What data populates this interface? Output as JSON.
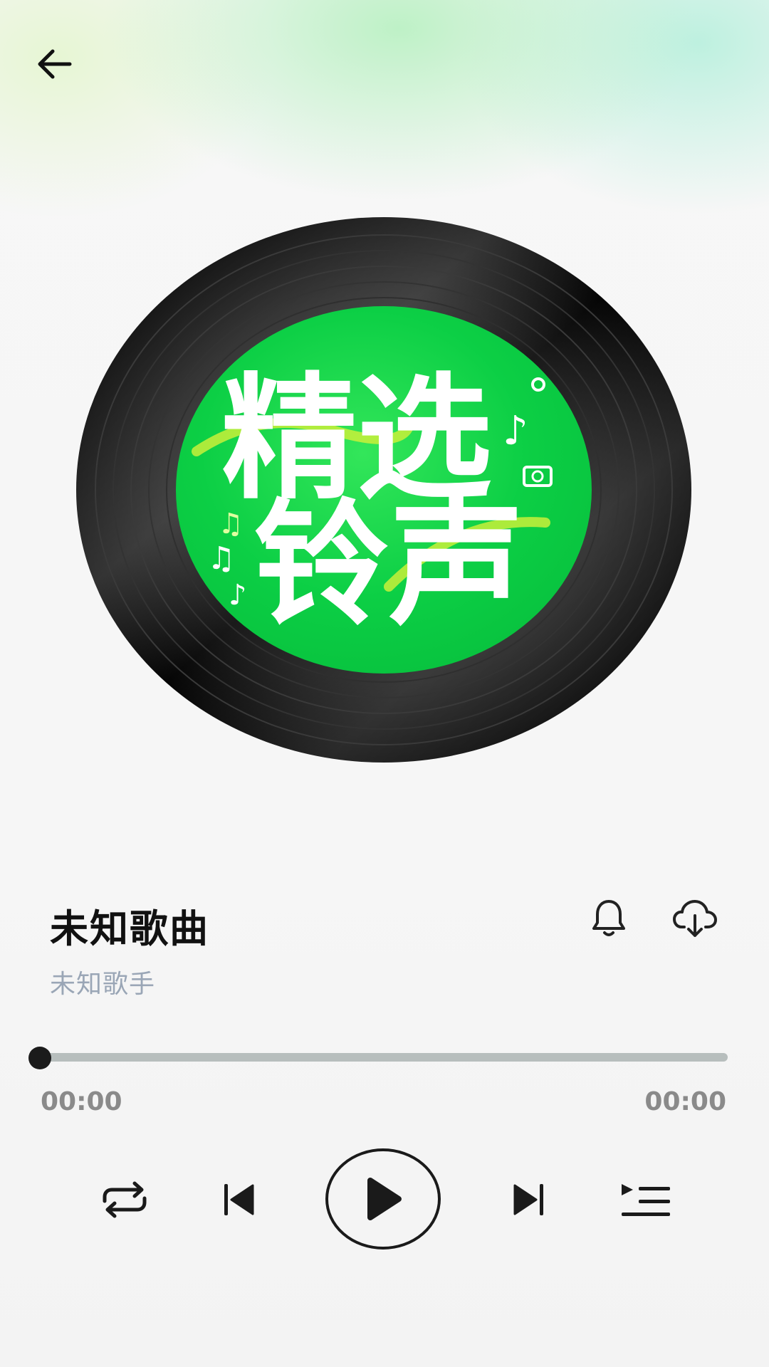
{
  "header": {
    "back_icon": "arrow-left-icon"
  },
  "album": {
    "cover_text_line1": "精选",
    "cover_text_line2": "铃声",
    "record_color": "#111111",
    "label_color": "#0ccf45"
  },
  "track": {
    "title": "未知歌曲",
    "artist": "未知歌手"
  },
  "actions": {
    "ringtone_icon": "bell-icon",
    "download_icon": "cloud-download-icon"
  },
  "progress": {
    "current_time": "00:00",
    "total_time": "00:00",
    "fraction": 0.0
  },
  "controls": {
    "repeat_icon": "repeat-icon",
    "previous_icon": "skip-previous-icon",
    "play_icon": "play-icon",
    "next_icon": "skip-next-icon",
    "queue_icon": "playlist-icon"
  },
  "colors": {
    "accent": "#0ccf45",
    "track": "#b7bebd",
    "thumb": "#1b1b1b",
    "time_text": "#8a8a8a",
    "artist_text": "#9aa6b6"
  }
}
